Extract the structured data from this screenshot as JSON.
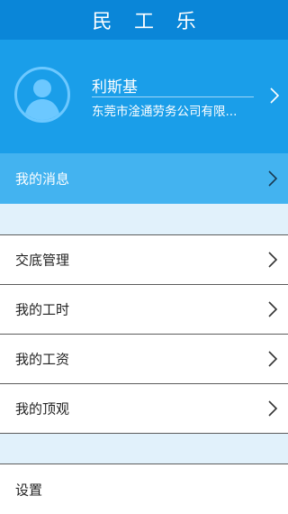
{
  "app": {
    "title": "民 工 乐"
  },
  "profile": {
    "name": "利斯基",
    "company": "东莞市淦通劳务公司有限..."
  },
  "menu": {
    "messages": "我的消息",
    "items": [
      {
        "label": "交底管理"
      },
      {
        "label": "我的工时"
      },
      {
        "label": "我的工资"
      },
      {
        "label": "我的顶观"
      }
    ],
    "settings": "设置"
  },
  "colors": {
    "title_bar": "#0a86d8",
    "profile_bg": "#1a9ee9",
    "highlight_row": "#43b3f0",
    "spacer": "#e1f1fb"
  },
  "icons": {
    "avatar": "person-silhouette-icon",
    "chevron": "chevron-right-icon"
  }
}
